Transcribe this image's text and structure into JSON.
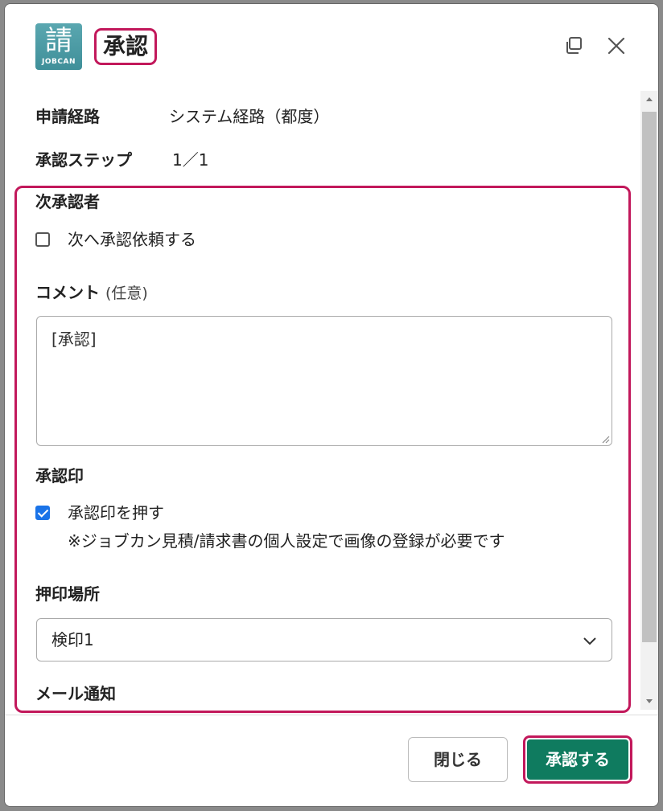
{
  "dialog": {
    "logo": {
      "glyph": "請",
      "text": "JOBCAN",
      "icon": "jobcan-logo-icon"
    },
    "title": "承認"
  },
  "info": {
    "route_label": "申請経路",
    "route_value": "システム経路（都度）",
    "step_label": "承認ステップ",
    "step_value": "1／1"
  },
  "next_approver": {
    "label": "次承認者",
    "checkbox_label": "次へ承認依頼する",
    "checked": false
  },
  "comment": {
    "label": "コメント",
    "optional": "(任意)",
    "value": "[承認]"
  },
  "stamp": {
    "label": "承認印",
    "checkbox_label": "承認印を押す",
    "checked": true,
    "note": "※ジョブカン見積/請求書の個人設定で画像の登録が必要です"
  },
  "stamp_location": {
    "label": "押印場所",
    "selected": "検印1"
  },
  "mail_notify": {
    "label": "メール通知"
  },
  "footer": {
    "close_label": "閉じる",
    "approve_label": "承認する"
  },
  "colors": {
    "approve": "#0f7b5f",
    "highlight": "#c2185b",
    "logo": "#4a9aa4"
  }
}
